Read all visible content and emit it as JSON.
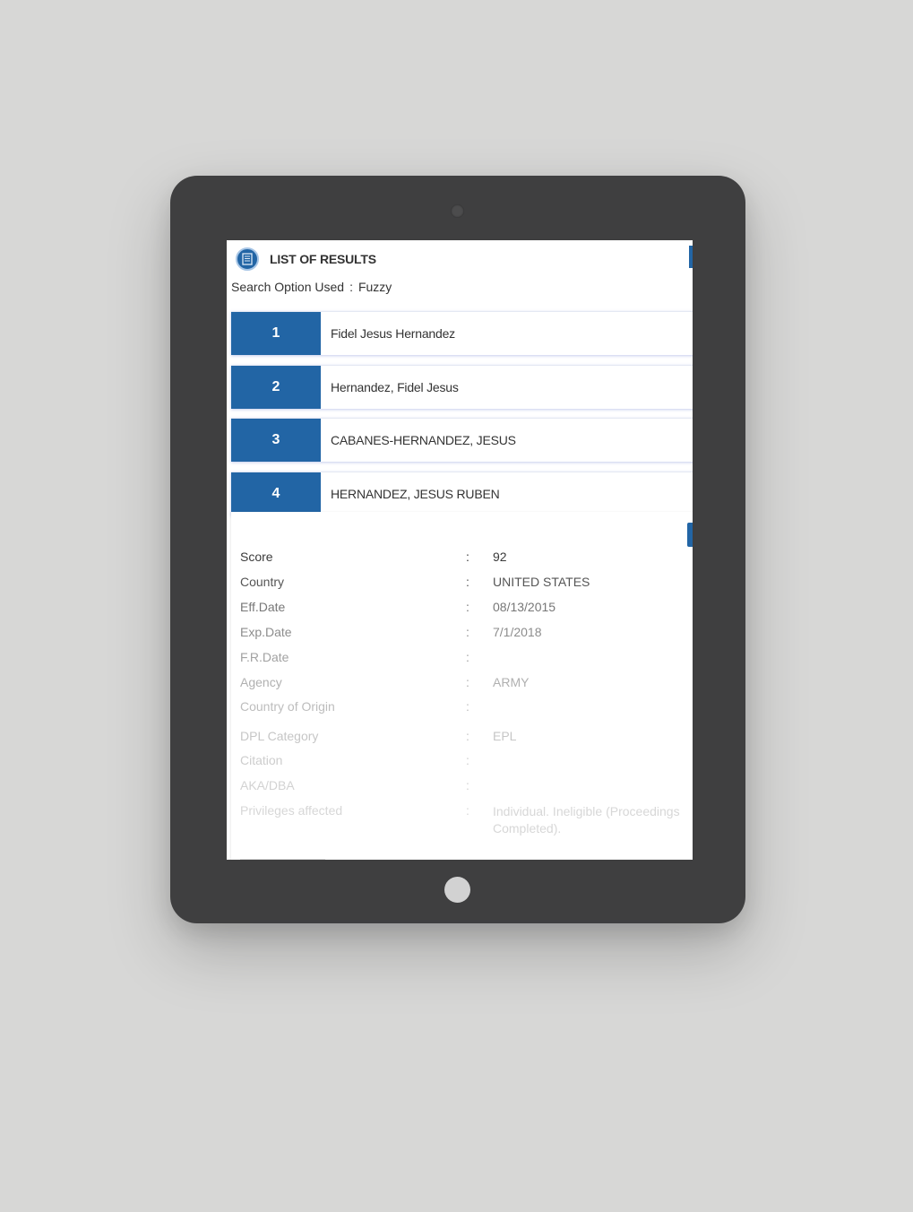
{
  "app": {
    "title": "LIST OF RESULTS",
    "search_option_label": "Search Option Used",
    "search_option_sep": ":",
    "search_option_value": "Fuzzy"
  },
  "results": [
    {
      "number": "1",
      "name": "Fidel Jesus Hernandez"
    },
    {
      "number": "2",
      "name": "Hernandez, Fidel Jesus"
    },
    {
      "number": "3",
      "name": "CABANES-HERNANDEZ, JESUS"
    },
    {
      "number": "4",
      "name": "HERNANDEZ, JESUS RUBEN"
    }
  ],
  "details": {
    "colon": ":",
    "rows": [
      {
        "label": "Score",
        "value": "92"
      },
      {
        "label": "Country",
        "value": "UNITED STATES"
      },
      {
        "label": "Eff.Date",
        "value": "08/13/2015"
      },
      {
        "label": "Exp.Date",
        "value": "7/1/2018"
      },
      {
        "label": "F.R.Date",
        "value": ""
      },
      {
        "label": "Agency",
        "value": "ARMY"
      },
      {
        "label": "Country of Origin",
        "value": ""
      },
      {
        "label": "DPL Category",
        "value": "EPL"
      },
      {
        "label": "Citation",
        "value": ""
      },
      {
        "label": "AKA/DBA",
        "value": ""
      },
      {
        "label": "Privileges affected",
        "value": "Individual. Ineligible (Proceedings Completed)."
      }
    ]
  },
  "colors": {
    "accent": "#2265a5",
    "device_frame": "#3f3f40",
    "background": "#d7d7d6"
  },
  "icons": {
    "logo": "document-list-icon",
    "camera": "camera-icon"
  }
}
